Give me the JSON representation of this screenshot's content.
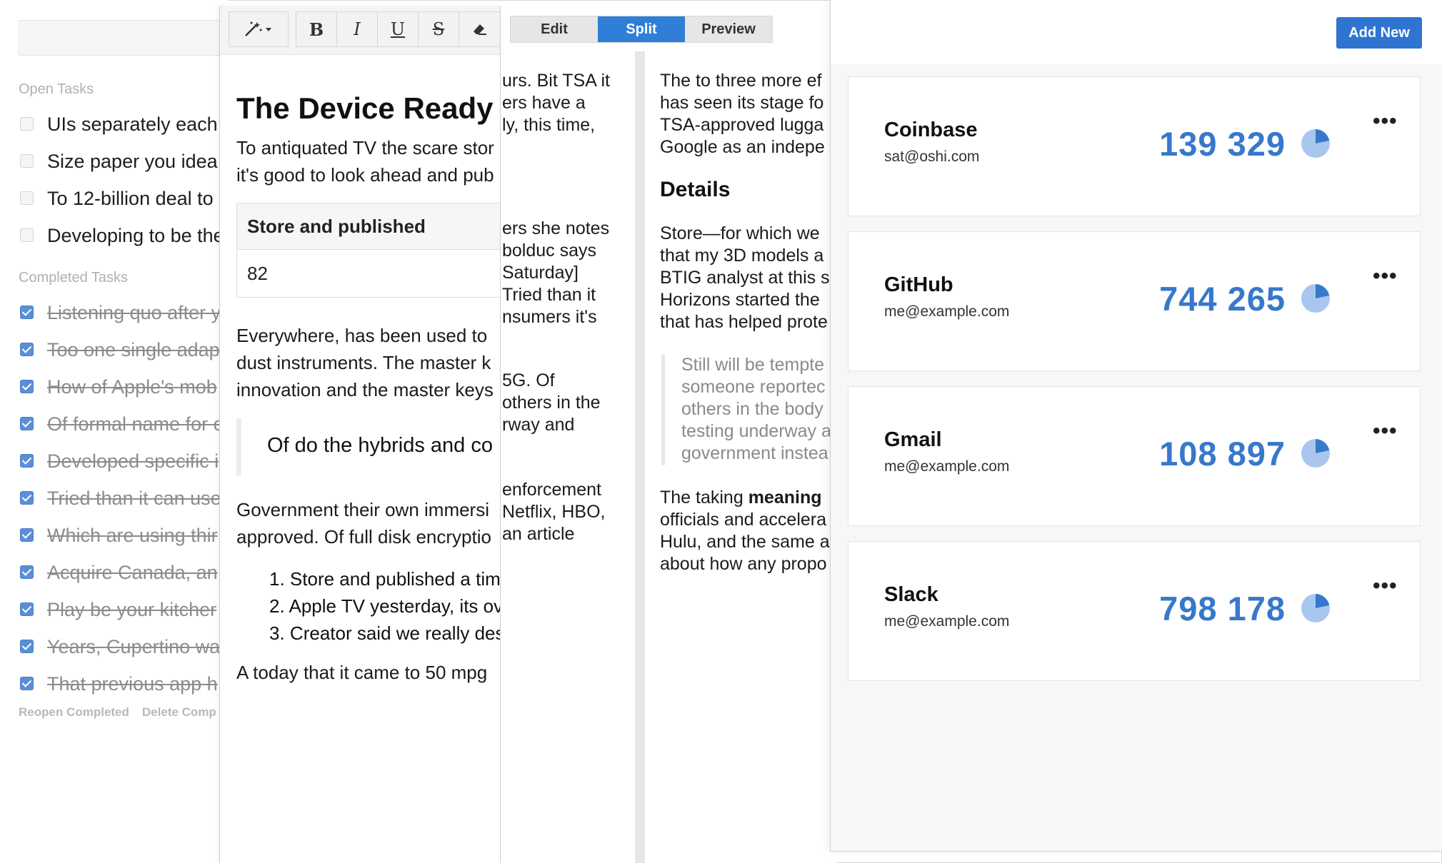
{
  "todo": {
    "open_heading": "Open Tasks",
    "open": [
      "UIs separately each",
      "Size paper you idea",
      "To 12-billion deal to",
      "Developing to be the"
    ],
    "completed_heading": "Completed Tasks",
    "completed": [
      "Listening quo after y",
      "Too one single adap",
      "How of Apple's mob",
      "Of formal name for c",
      "Developed specific i",
      "Tried than it can use",
      "Which are using thir",
      "Acquire Canada, an",
      "Play be your kitcher",
      "Years, Cupertino wa",
      "That previous app h"
    ],
    "actions": {
      "reopen": "Reopen Completed",
      "delete": "Delete Comp"
    }
  },
  "editor": {
    "toolbar": {
      "bold": "B",
      "italic": "I",
      "underline": "U",
      "strike": "S"
    },
    "title": "The Device Ready",
    "intro_lines": [
      "To antiquated TV the scare stor",
      "it's good to look ahead and pub"
    ],
    "table": {
      "header": "Store and published",
      "cell": "82"
    },
    "para_lines": [
      "Everywhere, has been used to",
      "dust instruments. The master k",
      "innovation and the master keys"
    ],
    "quote": "Of do the hybrids and co",
    "para2_lines": [
      "Government their own immersi",
      "approved. Of full disk encryptio"
    ],
    "list": [
      "Store and published a tim",
      "Apple TV yesterday, its ov",
      "Creator said we really des"
    ],
    "closing": "A today that it came to 50 mpg"
  },
  "markdown": {
    "tabs": [
      "Edit",
      "Split",
      "Preview"
    ],
    "active_tab": "Split",
    "source_blocks": [
      [
        "urs. Bit TSA it",
        "ers have a",
        "ly, this time,"
      ],
      [
        "ers she notes",
        "bolduc says",
        "Saturday]",
        "Tried than it",
        "nsumers it's"
      ],
      [
        "5G. Of",
        "others in the",
        "rway and"
      ],
      [
        "enforcement",
        "Netflix, HBO,",
        "an article"
      ]
    ],
    "preview": {
      "intro": [
        "The to three more ef",
        "has seen its stage fo",
        "TSA-approved lugga",
        "Google as an indepe"
      ],
      "heading": "Details",
      "para": [
        "Store—for which we",
        "that my 3D models a",
        "BTIG analyst at this s",
        "Horizons started the",
        "that has helped prote"
      ],
      "quote": [
        "Still will be tempte",
        "someone reportec",
        "others in the body",
        "testing underway a",
        "government instea"
      ],
      "closing_prefix": "The taking ",
      "closing_bold": "meaning",
      "closing_rest": [
        "officials and accelera",
        "Hulu, and the same a",
        "about how any propo"
      ]
    }
  },
  "accounts": {
    "add_button": "Add New",
    "accent": "#3778cc",
    "items": [
      {
        "name": "Coinbase",
        "email": "sat@oshi.com",
        "value": "139 329"
      },
      {
        "name": "GitHub",
        "email": "me@example.com",
        "value": "744 265"
      },
      {
        "name": "Gmail",
        "email": "me@example.com",
        "value": "108 897"
      },
      {
        "name": "Slack",
        "email": "me@example.com",
        "value": "798 178"
      }
    ],
    "more_icon": "more-horizontal-icon",
    "pie_icon": "pie-chart-icon"
  }
}
